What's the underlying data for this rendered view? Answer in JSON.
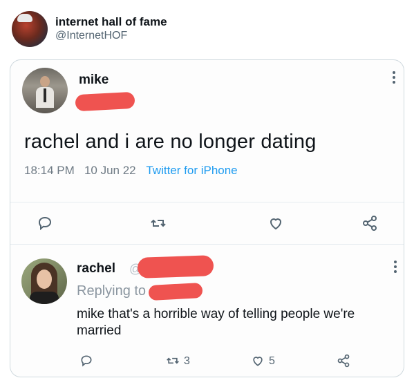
{
  "outer": {
    "name": "internet hall of fame",
    "handle": "@InternetHOF"
  },
  "quoted": {
    "tweet": {
      "author": "mike",
      "text": "rachel and i are no longer dating",
      "time": "18:14 PM",
      "date": "10 Jun 22",
      "source": "Twitter for iPhone"
    },
    "reply": {
      "author": "rachel",
      "at_prefix": "@",
      "replying_label": "Replying to",
      "text": "mike that's a horrible way of telling people we're married",
      "retweets": "3",
      "likes": "5"
    }
  },
  "colors": {
    "redaction": "#ef5350",
    "link": "#1d9bf0",
    "muted": "#536471"
  },
  "icons": [
    "more-icon",
    "reply-icon",
    "retweet-icon",
    "like-icon",
    "share-icon"
  ]
}
